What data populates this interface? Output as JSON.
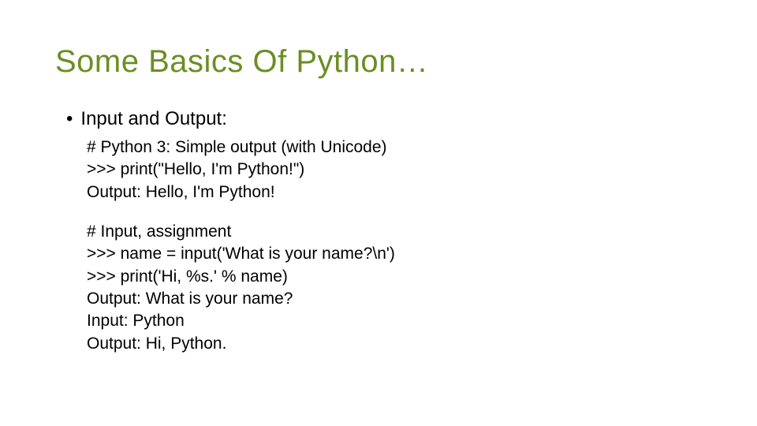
{
  "title": "Some Basics Of Python…",
  "bullet": "Input and Output:",
  "block1": {
    "l1": "# Python 3: Simple output (with Unicode)",
    "l2": ">>> print(\"Hello, I'm Python!\")",
    "l3": "Output: Hello, I'm Python!"
  },
  "block2": {
    "l1": "# Input, assignment",
    "l2": ">>> name = input('What is your name?\\n')",
    "l3": ">>> print('Hi, %s.' % name)",
    "l4": "Output: What is your name?",
    "l5": "Input: Python",
    "l6": "Output: Hi, Python."
  }
}
